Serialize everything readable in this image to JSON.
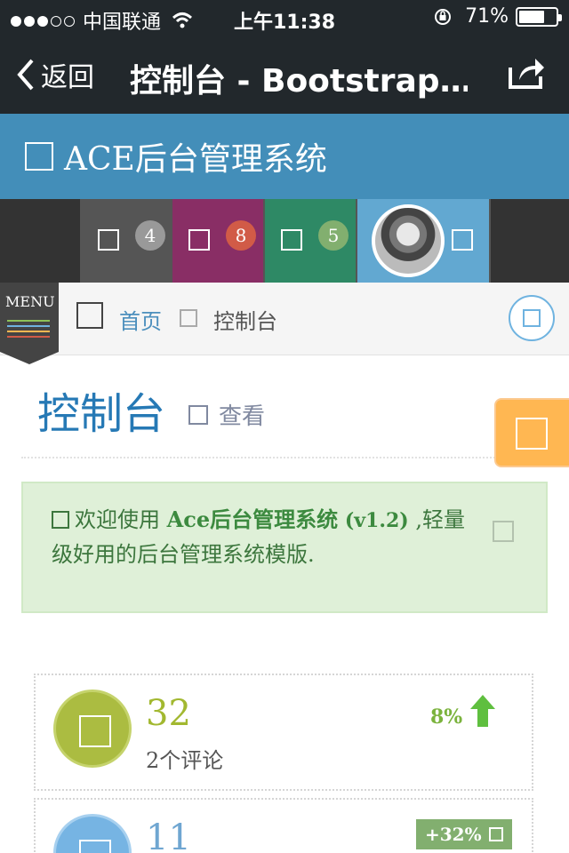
{
  "status_bar": {
    "carrier": "中国联通",
    "time": "上午11:38",
    "battery_percent": "71%",
    "battery_level": 0.71,
    "signal_bars_filled": 3,
    "signal_bars_total": 5
  },
  "nav_bar": {
    "back_label": "返回",
    "title": "控制台 - Bootstrap…",
    "share_icon": "share-icon"
  },
  "brand": {
    "title": "ACE后台管理系统",
    "icon": "square-icon",
    "color": "#438eb9"
  },
  "toolbar": {
    "tiles": [
      {
        "badge": "4",
        "color": "#555555",
        "badge_color": "#999999"
      },
      {
        "badge": "8",
        "color": "#892e65",
        "badge_color": "#d15b47"
      },
      {
        "badge": "5",
        "color": "#2e8965",
        "badge_color": "#82af6f"
      },
      {
        "badge": "",
        "color": "#62a8d1",
        "badge_color": ""
      }
    ]
  },
  "breadcrumb": {
    "menu_label": "MENU",
    "home_label": "首页",
    "current_label": "控制台"
  },
  "page_header": {
    "title": "控制台",
    "subtitle": "查看"
  },
  "alert": {
    "text_before": "欢迎使用 ",
    "strong": "Ace后台管理系统",
    "version": " (v1.2)",
    "text_after": " ,轻量级好用的后台管理系统模版."
  },
  "stats": [
    {
      "value": "32",
      "label": "2个评论",
      "change": "8%",
      "color": "#abbc41",
      "value_color": "#a2b830"
    },
    {
      "value": "11",
      "label": "",
      "change": "+32%",
      "color": "#76b4e3",
      "value_color": "#6fa6d1"
    }
  ]
}
